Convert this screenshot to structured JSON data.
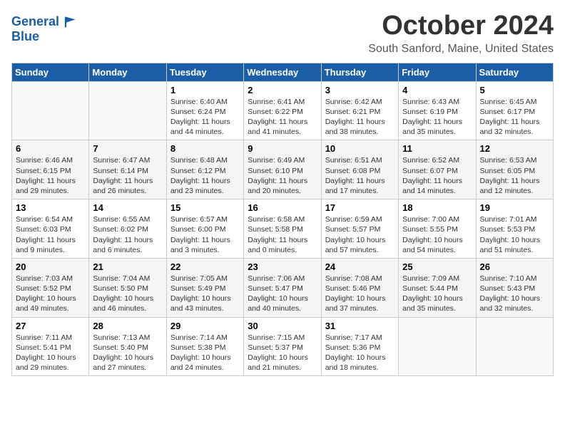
{
  "header": {
    "logo_line1": "General",
    "logo_line2": "Blue",
    "month_title": "October 2024",
    "location": "South Sanford, Maine, United States"
  },
  "days_of_week": [
    "Sunday",
    "Monday",
    "Tuesday",
    "Wednesday",
    "Thursday",
    "Friday",
    "Saturday"
  ],
  "weeks": [
    [
      {
        "day": "",
        "lines": []
      },
      {
        "day": "",
        "lines": []
      },
      {
        "day": "1",
        "lines": [
          "Sunrise: 6:40 AM",
          "Sunset: 6:24 PM",
          "Daylight: 11 hours",
          "and 44 minutes."
        ]
      },
      {
        "day": "2",
        "lines": [
          "Sunrise: 6:41 AM",
          "Sunset: 6:22 PM",
          "Daylight: 11 hours",
          "and 41 minutes."
        ]
      },
      {
        "day": "3",
        "lines": [
          "Sunrise: 6:42 AM",
          "Sunset: 6:21 PM",
          "Daylight: 11 hours",
          "and 38 minutes."
        ]
      },
      {
        "day": "4",
        "lines": [
          "Sunrise: 6:43 AM",
          "Sunset: 6:19 PM",
          "Daylight: 11 hours",
          "and 35 minutes."
        ]
      },
      {
        "day": "5",
        "lines": [
          "Sunrise: 6:45 AM",
          "Sunset: 6:17 PM",
          "Daylight: 11 hours",
          "and 32 minutes."
        ]
      }
    ],
    [
      {
        "day": "6",
        "lines": [
          "Sunrise: 6:46 AM",
          "Sunset: 6:15 PM",
          "Daylight: 11 hours",
          "and 29 minutes."
        ]
      },
      {
        "day": "7",
        "lines": [
          "Sunrise: 6:47 AM",
          "Sunset: 6:14 PM",
          "Daylight: 11 hours",
          "and 26 minutes."
        ]
      },
      {
        "day": "8",
        "lines": [
          "Sunrise: 6:48 AM",
          "Sunset: 6:12 PM",
          "Daylight: 11 hours",
          "and 23 minutes."
        ]
      },
      {
        "day": "9",
        "lines": [
          "Sunrise: 6:49 AM",
          "Sunset: 6:10 PM",
          "Daylight: 11 hours",
          "and 20 minutes."
        ]
      },
      {
        "day": "10",
        "lines": [
          "Sunrise: 6:51 AM",
          "Sunset: 6:08 PM",
          "Daylight: 11 hours",
          "and 17 minutes."
        ]
      },
      {
        "day": "11",
        "lines": [
          "Sunrise: 6:52 AM",
          "Sunset: 6:07 PM",
          "Daylight: 11 hours",
          "and 14 minutes."
        ]
      },
      {
        "day": "12",
        "lines": [
          "Sunrise: 6:53 AM",
          "Sunset: 6:05 PM",
          "Daylight: 11 hours",
          "and 12 minutes."
        ]
      }
    ],
    [
      {
        "day": "13",
        "lines": [
          "Sunrise: 6:54 AM",
          "Sunset: 6:03 PM",
          "Daylight: 11 hours",
          "and 9 minutes."
        ]
      },
      {
        "day": "14",
        "lines": [
          "Sunrise: 6:55 AM",
          "Sunset: 6:02 PM",
          "Daylight: 11 hours",
          "and 6 minutes."
        ]
      },
      {
        "day": "15",
        "lines": [
          "Sunrise: 6:57 AM",
          "Sunset: 6:00 PM",
          "Daylight: 11 hours",
          "and 3 minutes."
        ]
      },
      {
        "day": "16",
        "lines": [
          "Sunrise: 6:58 AM",
          "Sunset: 5:58 PM",
          "Daylight: 11 hours",
          "and 0 minutes."
        ]
      },
      {
        "day": "17",
        "lines": [
          "Sunrise: 6:59 AM",
          "Sunset: 5:57 PM",
          "Daylight: 10 hours",
          "and 57 minutes."
        ]
      },
      {
        "day": "18",
        "lines": [
          "Sunrise: 7:00 AM",
          "Sunset: 5:55 PM",
          "Daylight: 10 hours",
          "and 54 minutes."
        ]
      },
      {
        "day": "19",
        "lines": [
          "Sunrise: 7:01 AM",
          "Sunset: 5:53 PM",
          "Daylight: 10 hours",
          "and 51 minutes."
        ]
      }
    ],
    [
      {
        "day": "20",
        "lines": [
          "Sunrise: 7:03 AM",
          "Sunset: 5:52 PM",
          "Daylight: 10 hours",
          "and 49 minutes."
        ]
      },
      {
        "day": "21",
        "lines": [
          "Sunrise: 7:04 AM",
          "Sunset: 5:50 PM",
          "Daylight: 10 hours",
          "and 46 minutes."
        ]
      },
      {
        "day": "22",
        "lines": [
          "Sunrise: 7:05 AM",
          "Sunset: 5:49 PM",
          "Daylight: 10 hours",
          "and 43 minutes."
        ]
      },
      {
        "day": "23",
        "lines": [
          "Sunrise: 7:06 AM",
          "Sunset: 5:47 PM",
          "Daylight: 10 hours",
          "and 40 minutes."
        ]
      },
      {
        "day": "24",
        "lines": [
          "Sunrise: 7:08 AM",
          "Sunset: 5:46 PM",
          "Daylight: 10 hours",
          "and 37 minutes."
        ]
      },
      {
        "day": "25",
        "lines": [
          "Sunrise: 7:09 AM",
          "Sunset: 5:44 PM",
          "Daylight: 10 hours",
          "and 35 minutes."
        ]
      },
      {
        "day": "26",
        "lines": [
          "Sunrise: 7:10 AM",
          "Sunset: 5:43 PM",
          "Daylight: 10 hours",
          "and 32 minutes."
        ]
      }
    ],
    [
      {
        "day": "27",
        "lines": [
          "Sunrise: 7:11 AM",
          "Sunset: 5:41 PM",
          "Daylight: 10 hours",
          "and 29 minutes."
        ]
      },
      {
        "day": "28",
        "lines": [
          "Sunrise: 7:13 AM",
          "Sunset: 5:40 PM",
          "Daylight: 10 hours",
          "and 27 minutes."
        ]
      },
      {
        "day": "29",
        "lines": [
          "Sunrise: 7:14 AM",
          "Sunset: 5:38 PM",
          "Daylight: 10 hours",
          "and 24 minutes."
        ]
      },
      {
        "day": "30",
        "lines": [
          "Sunrise: 7:15 AM",
          "Sunset: 5:37 PM",
          "Daylight: 10 hours",
          "and 21 minutes."
        ]
      },
      {
        "day": "31",
        "lines": [
          "Sunrise: 7:17 AM",
          "Sunset: 5:36 PM",
          "Daylight: 10 hours",
          "and 18 minutes."
        ]
      },
      {
        "day": "",
        "lines": []
      },
      {
        "day": "",
        "lines": []
      }
    ]
  ]
}
